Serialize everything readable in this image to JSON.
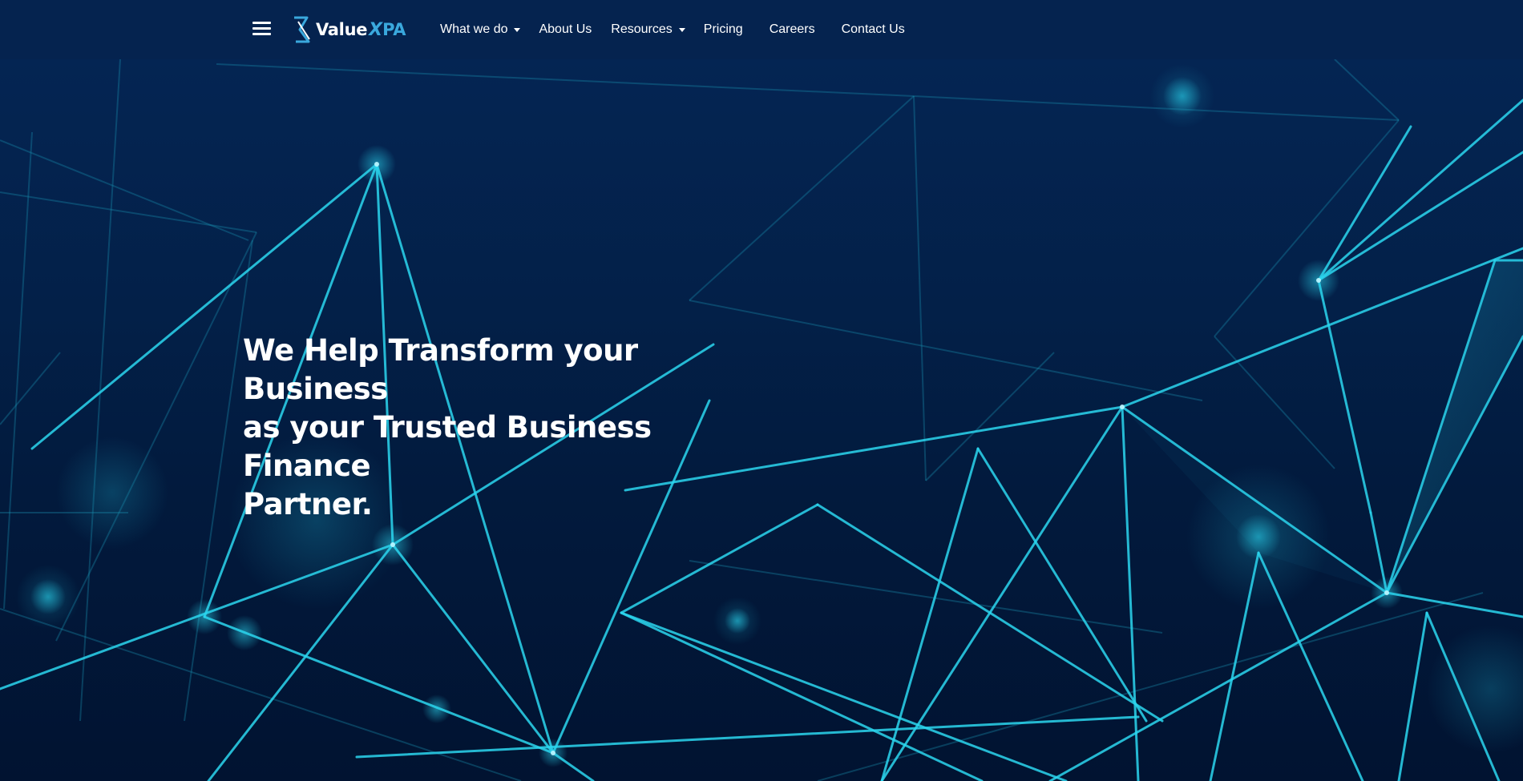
{
  "brand": {
    "logo_value": "Value",
    "logo_x": "X",
    "logo_pa": "PA"
  },
  "nav": {
    "items": [
      {
        "label": "What we do",
        "has_dropdown": true
      },
      {
        "label": "About Us",
        "has_dropdown": false
      },
      {
        "label": "Resources",
        "has_dropdown": true
      },
      {
        "label": "Pricing",
        "has_dropdown": false
      },
      {
        "label": "Careers",
        "has_dropdown": false
      },
      {
        "label": "Contact Us",
        "has_dropdown": false
      }
    ]
  },
  "hero": {
    "headline_line1": "We Help Transform your Business",
    "headline_line2": "as your Trusted Business Finance",
    "headline_line3": "Partner."
  },
  "colors": {
    "navbar_bg": "#05234f",
    "hero_bg": "#021a3d",
    "accent_cyan": "#29d3ea",
    "logo_blue": "#3aa8dd",
    "text": "#ffffff"
  },
  "icons": [
    "hamburger-menu-icon",
    "valuexpa-logo-mark",
    "caret-down-icon"
  ]
}
